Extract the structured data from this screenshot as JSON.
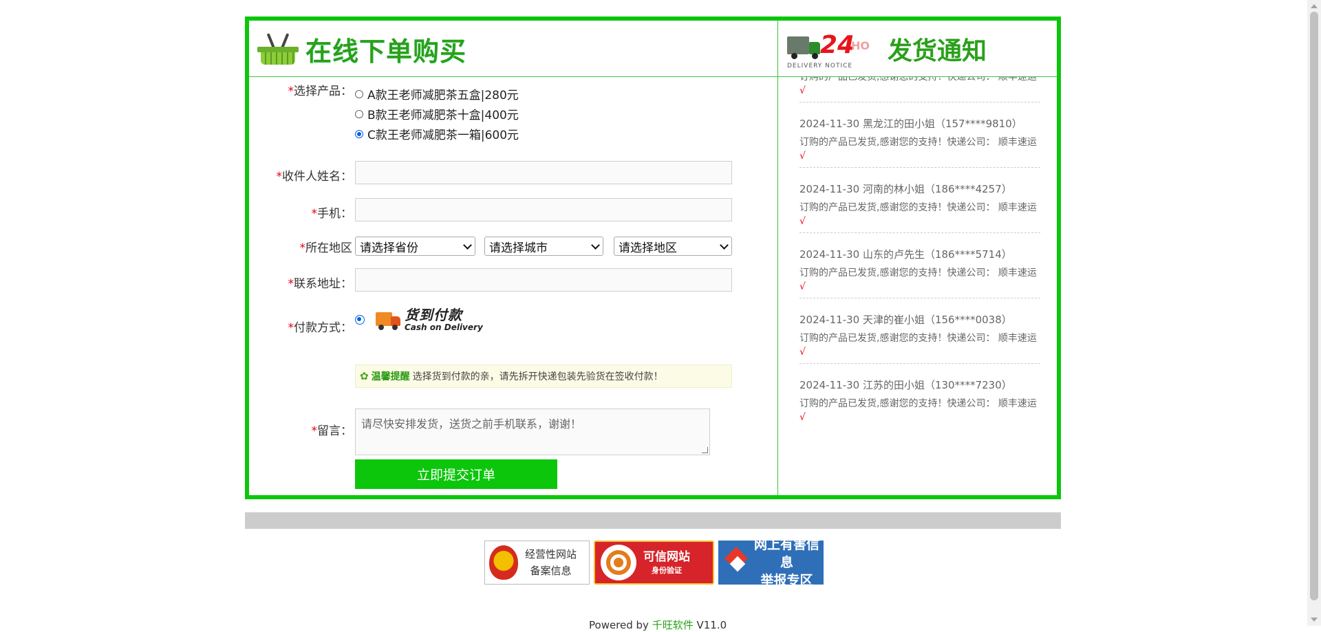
{
  "header": {
    "order_title": "在线下单购买",
    "delivery_24": "24",
    "delivery_hrs": "HO",
    "delivery_notice_en": "DELIVERY NOTICE",
    "delivery_title": "发货通知"
  },
  "form": {
    "product_label": "选择产品：",
    "products": [
      {
        "label": "A款王老师减肥茶五盒|280元",
        "selected": false
      },
      {
        "label": "B款王老师减肥茶十盒|400元",
        "selected": false
      },
      {
        "label": "C款王老师减肥茶一箱|600元",
        "selected": true
      }
    ],
    "name_label": "收件人姓名：",
    "phone_label": "手机：",
    "region_label": "所在地区",
    "province_select": "请选择省份",
    "city_select": "请选择城市",
    "district_select": "请选择地区",
    "address_label": "联系地址：",
    "payment_label": "付款方式：",
    "cod_cn": "货到付款",
    "cod_en": "Cash on Delivery",
    "tip_title": "温馨提醒",
    "tip_text": "选择货到付款的亲，请先拆开快递包装先验货在签收付款！",
    "message_label": "留言：",
    "message_placeholder": "请尽快安排发货，送货之前手机联系，谢谢！",
    "submit_label": "立即提交订单",
    "required_mark": "*"
  },
  "notices": [
    {
      "head": "",
      "body": "订购的产品已发货,感谢您的支持！快递公司： 顺丰速运",
      "tick": "√"
    },
    {
      "head": "2024-11-30 黑龙江的田小姐（157****9810）",
      "body": "订购的产品已发货,感谢您的支持！快递公司： 顺丰速运",
      "tick": "√"
    },
    {
      "head": "2024-11-30 河南的林小姐（186****4257）",
      "body": "订购的产品已发货,感谢您的支持！快递公司： 顺丰速运",
      "tick": "√"
    },
    {
      "head": "2024-11-30 山东的卢先生（186****5714）",
      "body": "订购的产品已发货,感谢您的支持！快递公司： 顺丰速运",
      "tick": "√"
    },
    {
      "head": "2024-11-30 天津的崔小姐（156****0038）",
      "body": "订购的产品已发货,感谢您的支持！快递公司： 顺丰速运",
      "tick": "√"
    },
    {
      "head": "2024-11-30 江苏的田小姐（130****7230）",
      "body": "订购的产品已发货,感谢您的支持！快递公司： 顺丰速运",
      "tick": "√"
    }
  ],
  "badges": {
    "b1_line1": "经营性网站",
    "b1_line2": "备案信息",
    "b2_line1": "可信网站",
    "b2_line2": "身份验证",
    "b3_line1": "网上有害信息",
    "b3_line2": "举报专区"
  },
  "footer": {
    "powered_prefix": "Powered by ",
    "powered_brand": "千旺软件",
    "powered_version": " V11.0"
  },
  "colors": {
    "accent_green": "#0cc60c",
    "required_red": "#e60012"
  }
}
